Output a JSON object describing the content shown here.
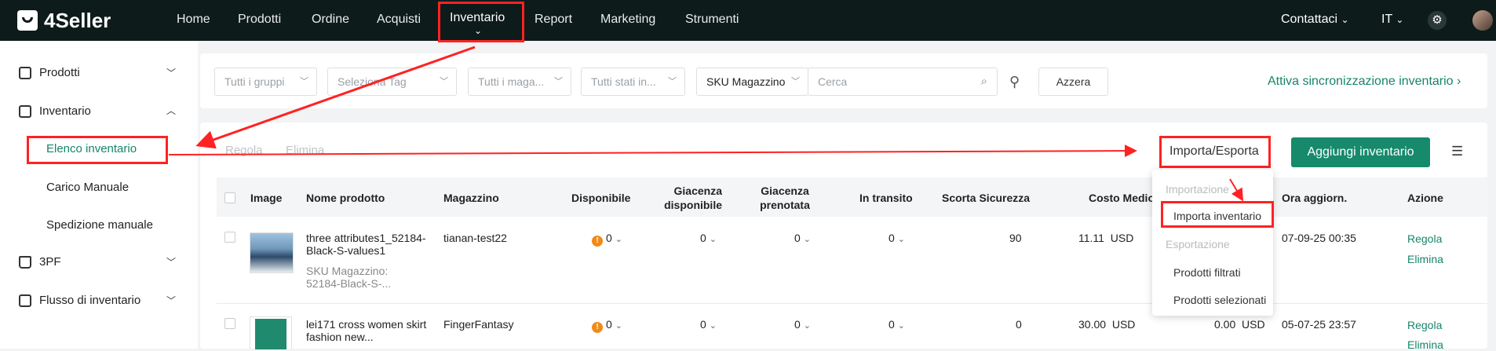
{
  "brand": {
    "name": "4Seller"
  },
  "nav": {
    "items": [
      "Home",
      "Prodotti",
      "Ordine",
      "Acquisti",
      "Inventario",
      "Report",
      "Marketing",
      "Strumenti"
    ],
    "contacts": "Contattaci",
    "language": "IT"
  },
  "sidebar": {
    "prodotti": "Prodotti",
    "inventario": "Inventario",
    "sub": [
      "Elenco inventario",
      "Carico Manuale",
      "Spedizione manuale"
    ],
    "pf": "3PF",
    "flusso": "Flusso di inventario"
  },
  "filters": {
    "groups": "Tutti i gruppi",
    "tag": "Seleziona Tag",
    "warehouse": "Tutti i maga...",
    "status": "Tutti stati in...",
    "sku_select": "SKU Magazzino",
    "search_placeholder": "Cerca",
    "reset": "Azzera",
    "sync_link": "Attiva sincronizzazione inventario"
  },
  "toolbar": {
    "adjust": "Regola",
    "delete": "Elimina",
    "import_export": "Importa/Esporta",
    "add": "Aggiungi inventario"
  },
  "table": {
    "headers": {
      "image": "Image",
      "name": "Nome prodotto",
      "warehouse": "Magazzino",
      "available": "Disponibile",
      "giacenza_disp": "Giacenza disponibile",
      "giacenza_pren": "Giacenza prenotata",
      "transit": "In transito",
      "safety": "Scorta Sicurezza",
      "cost": "Costo Medio",
      "updated": "Ora aggiorn.",
      "action": "Azione"
    },
    "rows": [
      {
        "name": "three attributes1_52184-Black-S-values1",
        "sku": "SKU Magazzino: 52184-Black-S-...",
        "warehouse": "tianan-test22",
        "available": "0",
        "giacenza_disp": "0",
        "giacenza_pren": "0",
        "transit": "0",
        "safety": "90",
        "cost": "11.11",
        "currency": "USD",
        "updated": "07-09-25 00:35",
        "action1": "Regola",
        "action2": "Elimina"
      },
      {
        "name": "lei171 cross women skirt fashion new...",
        "warehouse": "FingerFantasy",
        "available": "0",
        "giacenza_disp": "0",
        "giacenza_pren": "0",
        "transit": "0",
        "safety": "0",
        "cost": "30.00",
        "currency": "USD",
        "cost2": "0.00",
        "currency2": "USD",
        "updated": "05-07-25 23:57",
        "action1": "Regola",
        "action2": "Elimina"
      }
    ]
  },
  "dropdown": {
    "import_head": "Importazione",
    "import_item": "Importa inventario",
    "export_head": "Esportazione",
    "export_items": [
      "Prodotti filtrati",
      "Prodotti selezionati"
    ]
  },
  "colors": {
    "accent": "#168a6b",
    "nav_bg": "#0d1b1a",
    "highlight": "#ff2222"
  },
  "icons": [
    "search-icon",
    "filter-icon",
    "settings-icon",
    "list-settings-icon",
    "warning-icon",
    "chevron-down-icon"
  ]
}
